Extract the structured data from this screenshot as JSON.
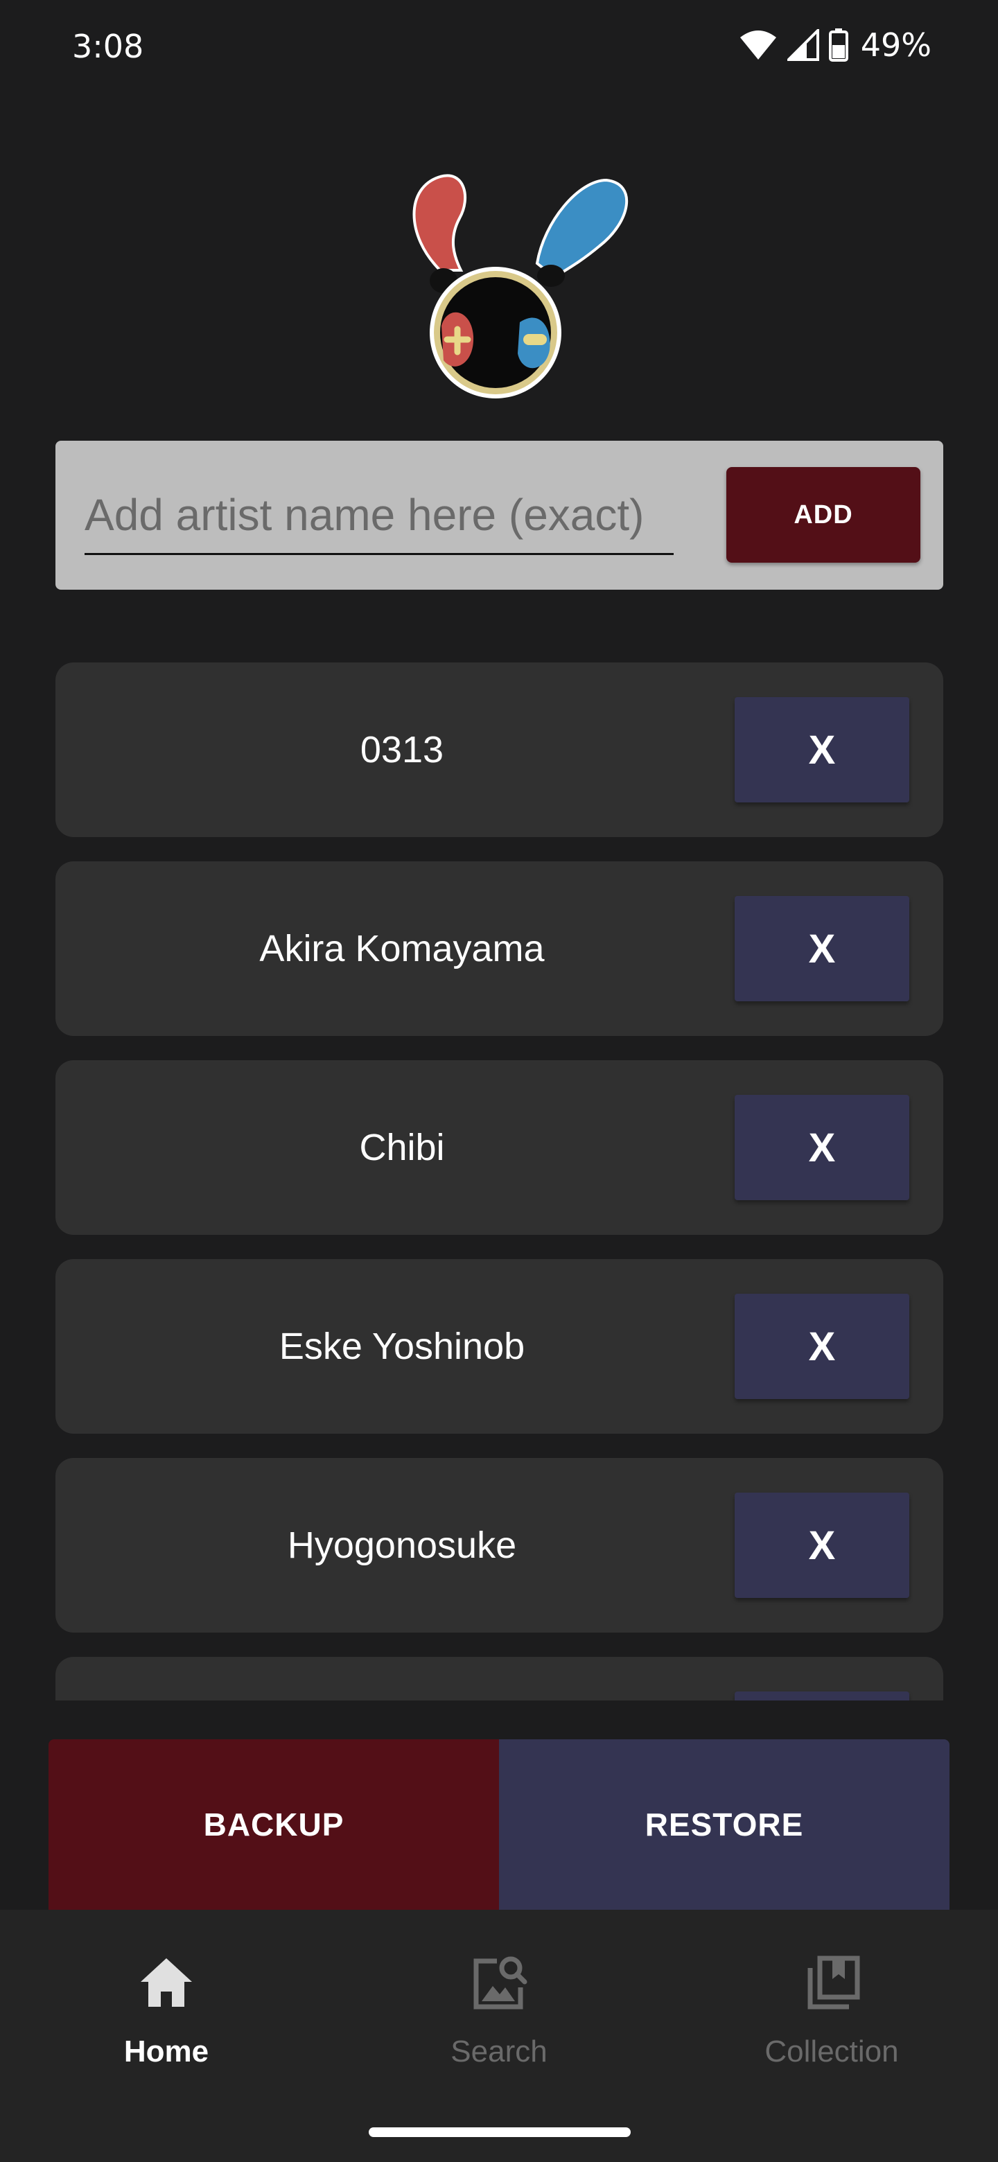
{
  "status_bar": {
    "time": "3:08",
    "battery": "49%",
    "icons": [
      "wifi-icon",
      "signal-icon",
      "battery-icon"
    ]
  },
  "add_panel": {
    "placeholder": "Add artist name here (exact)",
    "value": "",
    "add_label": "ADD"
  },
  "artists": [
    {
      "name": "0313",
      "remove_label": "X"
    },
    {
      "name": "Akira Komayama",
      "remove_label": "X"
    },
    {
      "name": "Chibi",
      "remove_label": "X"
    },
    {
      "name": "Eske Yoshinob",
      "remove_label": "X"
    },
    {
      "name": "Hyogonosuke",
      "remove_label": "X"
    }
  ],
  "actions": {
    "backup_label": "BACKUP",
    "restore_label": "RESTORE"
  },
  "bottom_nav": {
    "items": [
      {
        "label": "Home",
        "icon": "home-icon",
        "active": true
      },
      {
        "label": "Search",
        "icon": "image-search-icon",
        "active": false
      },
      {
        "label": "Collection",
        "icon": "collection-icon",
        "active": false
      }
    ]
  },
  "colors": {
    "background": "#1c1c1d",
    "add_button": "#530f17",
    "remove_button": "#343452",
    "backup_button": "#530f17",
    "restore_button": "#343452",
    "panel": "#bdbdbd",
    "row": "#303030",
    "nav_background": "#242424"
  }
}
